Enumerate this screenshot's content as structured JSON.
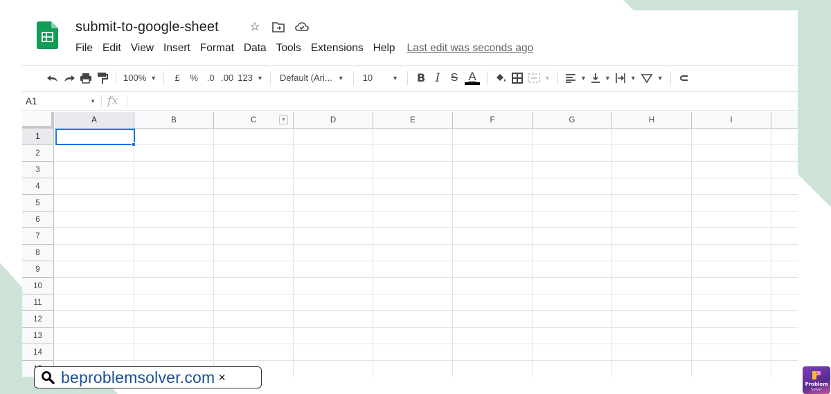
{
  "doc": {
    "title": "submit-to-google-sheet",
    "last_edit": "Last edit was seconds ago"
  },
  "menu": [
    "File",
    "Edit",
    "View",
    "Insert",
    "Format",
    "Data",
    "Tools",
    "Extensions",
    "Help"
  ],
  "toolbar": {
    "zoom": "100%",
    "currency": "£",
    "percent": "%",
    "decrease_decimal": ".0",
    "increase_decimal": ".00",
    "more_formats": "123",
    "font": "Default (Ari...",
    "font_size": "10",
    "bold": "B",
    "italic": "I",
    "strike": "S",
    "text_color": "A"
  },
  "formula_bar": {
    "name_box": "A1",
    "fx": "fx",
    "value": ""
  },
  "grid": {
    "columns": [
      "A",
      "B",
      "C",
      "D",
      "E",
      "F",
      "G",
      "H",
      "I"
    ],
    "rows": [
      "1",
      "2",
      "3",
      "4",
      "5",
      "6",
      "7",
      "8",
      "9",
      "10",
      "11",
      "12",
      "13",
      "14",
      "15"
    ],
    "active_cell": "A1",
    "filter_column": "C"
  },
  "search": {
    "query": "beproblemsolver.com",
    "clear": "×"
  },
  "brand": {
    "line1": "Problem",
    "line2": "Solver"
  },
  "colors": {
    "accent": "#1a73e8",
    "sheets_green": "#0f9d58",
    "background_shape": "#cde3d8"
  }
}
